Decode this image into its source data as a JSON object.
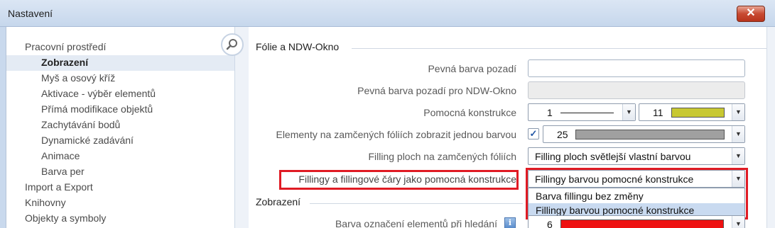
{
  "window": {
    "title": "Nastavení",
    "close_glyph": "✕"
  },
  "sidebar": {
    "items": [
      {
        "label": "Pracovní prostředí"
      },
      {
        "label": "Zobrazení"
      },
      {
        "label": "Myš a osový kříž"
      },
      {
        "label": "Aktivace - výběr elementů"
      },
      {
        "label": "Přímá modifikace objektů"
      },
      {
        "label": "Zachytávání bodů"
      },
      {
        "label": "Dynamické zadávání"
      },
      {
        "label": "Animace"
      },
      {
        "label": "Barva per"
      },
      {
        "label": "Import a Export"
      },
      {
        "label": "Knihovny"
      },
      {
        "label": "Objekty a symboly"
      }
    ],
    "selected": "Zobrazení"
  },
  "sections": {
    "folie": {
      "title": "Fólie a NDW-Okno"
    },
    "zobrazeni": {
      "title": "Zobrazení"
    }
  },
  "rows": {
    "pevna_barva": {
      "label": "Pevná barva pozadí",
      "value": ""
    },
    "pevna_barva_ndw": {
      "label": "Pevná barva pozadí pro NDW-Okno",
      "value": ""
    },
    "pomocna": {
      "label": "Pomocná konstrukce",
      "line_value": "1",
      "color_value": "11",
      "color_hex": "#c8c832"
    },
    "zamcene": {
      "label": "Elementy na zamčených fóliích zobrazit jednou barvou",
      "checked": true,
      "color_value": "25",
      "color_hex": "#a0a0a0"
    },
    "filling_plochy": {
      "label": "Filling ploch na zamčených fóliích",
      "value": "Filling ploch světlejší vlastní barvou"
    },
    "fillingy_cary": {
      "label": "Fillingy a fillingové čáry jako pomocná konstrukce",
      "value": "Fillingy barvou pomocné konstrukce",
      "options": [
        "Barva fillingu bez změny",
        "Fillingy barvou pomocné konstrukce"
      ]
    },
    "barva_oznaceni": {
      "label": "Barva označení elementů při hledání",
      "value": "6",
      "color_hex": "#ee1111",
      "info_icon": "info-icon"
    }
  },
  "colors": {
    "highlight": "#e01b24",
    "accent": "#2458a6"
  }
}
